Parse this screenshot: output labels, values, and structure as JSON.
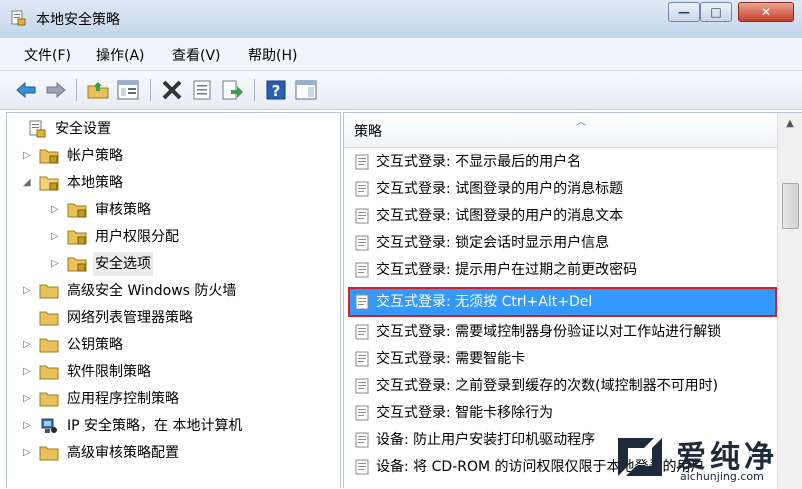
{
  "window": {
    "title": "本地安全策略"
  },
  "window_buttons": {
    "minimize": "—",
    "maximize": "□",
    "close": "✕"
  },
  "menu": [
    "文件(F)",
    "操作(A)",
    "查看(V)",
    "帮助(H)"
  ],
  "toolbar": [
    "back-arrow-icon",
    "forward-arrow-icon",
    "up-folder-icon",
    "show-hide-tree-icon",
    "delete-icon",
    "properties-icon",
    "export-icon",
    "help-icon",
    "console-icon"
  ],
  "tree": [
    {
      "label": "安全设置",
      "twisty": ""
    },
    {
      "label": "帐户策略",
      "twisty": "▷"
    },
    {
      "label": "本地策略",
      "twisty": "◢"
    },
    {
      "label": "审核策略",
      "twisty": "▷"
    },
    {
      "label": "用户权限分配",
      "twisty": "▷"
    },
    {
      "label": "安全选项",
      "twisty": "▷"
    },
    {
      "label": "高级安全 Windows 防火墙",
      "twisty": "▷"
    },
    {
      "label": "网络列表管理器策略",
      "twisty": ""
    },
    {
      "label": "公钥策略",
      "twisty": "▷"
    },
    {
      "label": "软件限制策略",
      "twisty": "▷"
    },
    {
      "label": "应用程序控制策略",
      "twisty": "▷"
    },
    {
      "label": "IP 安全策略，在 本地计算机",
      "twisty": "▷"
    },
    {
      "label": "高级审核策略配置",
      "twisty": "▷"
    }
  ],
  "list_header": "策略",
  "policies": [
    "交互式登录: 不显示最后的用户名",
    "交互式登录: 试图登录的用户的消息标题",
    "交互式登录: 试图登录的用户的消息文本",
    "交互式登录: 锁定会话时显示用户信息",
    "交互式登录: 提示用户在过期之前更改密码",
    "交互式登录: 无须按 Ctrl+Alt+Del",
    "交互式登录: 需要域控制器身份验证以对工作站进行解锁",
    "交互式登录: 需要智能卡",
    "交互式登录: 之前登录到缓存的次数(域控制器不可用时)",
    "交互式登录: 智能卡移除行为",
    "设备: 防止用户安装打印机驱动程序",
    "设备: 将 CD-ROM 的访问权限仅限于本地登录的用户"
  ],
  "selected_policy_index": 5,
  "watermark": {
    "brand": "爱纯净",
    "url": "aichunjing.com"
  },
  "colors": {
    "selection": "#3399ff",
    "highlight_border": "#d32020",
    "folder": "#e8c15a"
  }
}
